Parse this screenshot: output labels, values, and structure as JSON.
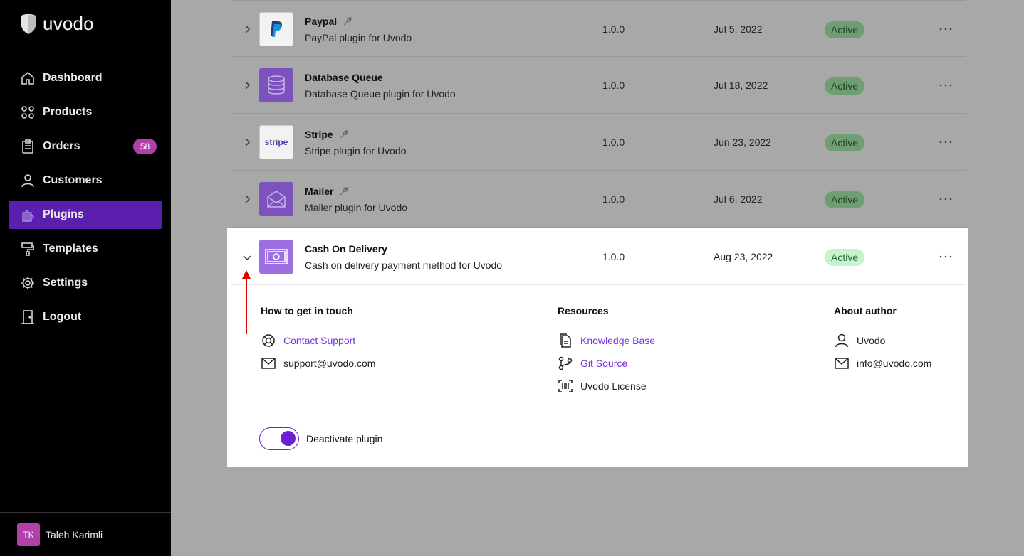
{
  "brand": {
    "name": "uvodo"
  },
  "sidebar": {
    "items": [
      {
        "label": "Dashboard",
        "icon": "home-icon"
      },
      {
        "label": "Products",
        "icon": "grid-icon"
      },
      {
        "label": "Orders",
        "icon": "clipboard-icon",
        "badge": "58"
      },
      {
        "label": "Customers",
        "icon": "user-icon"
      },
      {
        "label": "Plugins",
        "icon": "puzzle-icon",
        "active": true
      },
      {
        "label": "Templates",
        "icon": "paint-roller-icon"
      },
      {
        "label": "Settings",
        "icon": "gear-icon"
      },
      {
        "label": "Logout",
        "icon": "door-icon"
      }
    ],
    "user": {
      "initials": "TK",
      "name": "Taleh Karimli"
    }
  },
  "plugins": [
    {
      "name": "Paypal",
      "description": "PayPal plugin for Uvodo",
      "version": "1.0.0",
      "date": "Jul 5, 2022",
      "status": "Active",
      "icon": "paypal-icon",
      "wrench": true
    },
    {
      "name": "Database Queue",
      "description": "Database Queue plugin for Uvodo",
      "version": "1.0.0",
      "date": "Jul 18, 2022",
      "status": "Active",
      "icon": "database-icon",
      "wrench": false
    },
    {
      "name": "Stripe",
      "description": "Stripe plugin for Uvodo",
      "version": "1.0.0",
      "date": "Jun 23, 2022",
      "status": "Active",
      "icon": "stripe-icon",
      "icon_text": "stripe",
      "wrench": true
    },
    {
      "name": "Mailer",
      "description": "Mailer plugin for Uvodo",
      "version": "1.0.0",
      "date": "Jul 6, 2022",
      "status": "Active",
      "icon": "envelope-icon",
      "wrench": true
    }
  ],
  "expanded": {
    "name": "Cash On Delivery",
    "description": "Cash on delivery payment method for Uvodo",
    "version": "1.0.0",
    "date": "Aug 23, 2022",
    "status": "Active",
    "icon": "banknote-icon",
    "contact": {
      "title": "How to get in touch",
      "support_link": "Contact Support",
      "email": "support@uvodo.com"
    },
    "resources": {
      "title": "Resources",
      "knowledge_base": "Knowledge Base",
      "git_source": "Git Source",
      "license": "Uvodo License"
    },
    "author": {
      "title": "About author",
      "name": "Uvodo",
      "email": "info@uvodo.com"
    },
    "toggle_label": "Deactivate plugin",
    "toggle_on": true
  },
  "colors": {
    "accent": "#6a21d6",
    "active_nav": "#5b1fb0",
    "badge": "#b340a8",
    "status_bg": "#c7f2d0",
    "annotation_arrow": "#e00000"
  }
}
